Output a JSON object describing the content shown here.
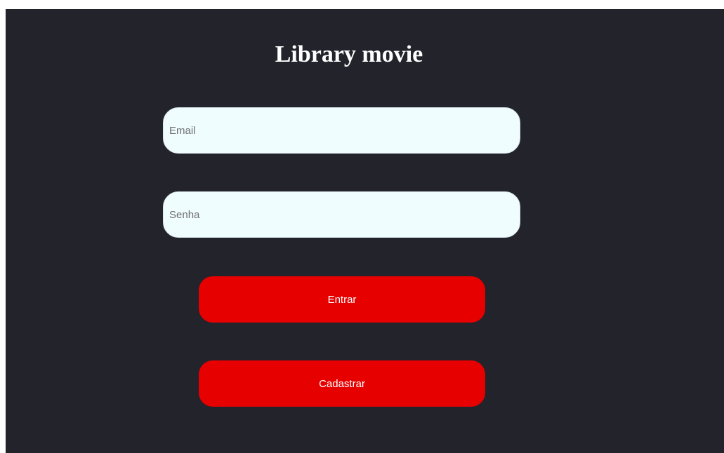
{
  "page": {
    "title": "Library movie"
  },
  "form": {
    "email_placeholder": "Email",
    "email_value": "",
    "password_placeholder": "Senha",
    "password_value": "",
    "login_label": "Entrar",
    "register_label": "Cadastrar"
  },
  "colors": {
    "background": "#23232b",
    "input_background": "#effdff",
    "button_background": "#e60000",
    "button_text": "#ffffff",
    "title_text": "#ffffff"
  }
}
